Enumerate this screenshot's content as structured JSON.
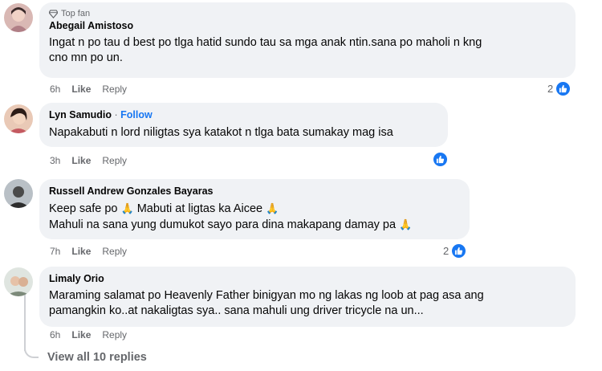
{
  "comments": [
    {
      "badge": "Top fan",
      "name": "Abegail Amistoso",
      "lines": [
        "Ingat n po tau d best po tlga hatid sundo tau sa mga anak ntin.sana po maholi n kng",
        "cno mn po un."
      ],
      "time": "6h",
      "like": "Like",
      "reply": "Reply",
      "reaction_count": "2"
    },
    {
      "name": "Lyn Samudio",
      "follow": "Follow",
      "lines": [
        "Napakabuti n lord niligtas sya katakot n tlga bata sumakay mag isa"
      ],
      "time": "3h",
      "like": "Like",
      "reply": "Reply",
      "reaction_count": ""
    },
    {
      "name": "Russell Andrew Gonzales Bayaras",
      "lines": [
        "Keep safe po",
        "Mabuti at ligtas ka Aicee",
        "Mahuli na sana yung dumukot sayo para dina makapang damay pa"
      ],
      "time": "7h",
      "like": "Like",
      "reply": "Reply",
      "reaction_count": "2"
    },
    {
      "name": "Limaly Orio",
      "lines": [
        "Maraming salamat po Heavenly Father binigyan mo ng lakas ng loob at pag asa ang",
        "pamangkin ko..at nakaligtas sya.. sana mahuli ung driver tricycle na un..."
      ],
      "time": "6h",
      "like": "Like",
      "reply": "Reply"
    }
  ],
  "view_replies": "View all 10 replies",
  "colors": {
    "accent": "#1877f2",
    "bubble": "#f0f2f5",
    "muted": "#65676b"
  },
  "icons": {
    "badge": "diamond-icon",
    "reaction": "thumbs-up-icon",
    "emoji": "folded-hands-emoji"
  }
}
